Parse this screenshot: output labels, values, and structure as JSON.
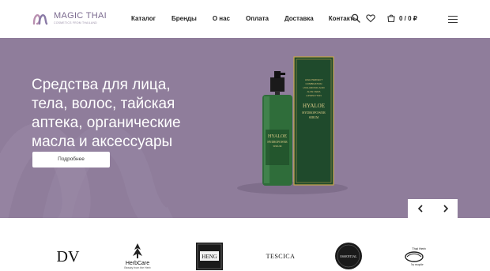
{
  "header": {
    "logo": {
      "name": "MAGIC THAI",
      "tagline": "COSMETICS FROM THAILAND"
    },
    "nav": [
      "Каталог",
      "Бренды",
      "О нас",
      "Оплата",
      "Доставка",
      "Контакты"
    ],
    "cart_total": "0 / 0 ₽",
    "icons": [
      "search-icon",
      "heart-icon",
      "cart-icon",
      "menu-icon"
    ]
  },
  "banner": {
    "headline_lines": [
      "Средства для лица,",
      "тела, волос, тайская",
      "аптека, органические",
      "масла и аксессуары"
    ],
    "button_label": "Подробнее",
    "product": {
      "box_text": [
        "HIGH PERFECT",
        "COMBINATION",
        "HYALURONIC ACID",
        "ALOE VERA",
        "LIPOPHYTON",
        "HYALOE",
        "HYDROPOWER",
        "SERUM"
      ],
      "bottle_label": [
        "HYALOE",
        "HYDROPOWER",
        "SERUM"
      ]
    },
    "colors": {
      "background": "#8f7d9b",
      "button": "#ffffff"
    }
  },
  "brands": [
    {
      "name": "DV",
      "icon": "dv-logo"
    },
    {
      "name": "HerbCare",
      "sub": "Beauty from the Herb",
      "icon": "herbcare-logo"
    },
    {
      "name": "HENG",
      "icon": "heng-logo"
    },
    {
      "name": "TESCICA",
      "icon": "tescica-logo"
    },
    {
      "name": "ESSENTIAL",
      "icon": "essential-logo"
    },
    {
      "name": "Thai Herb",
      "sub": "by mapite",
      "icon": "thaiherb-logo"
    }
  ]
}
